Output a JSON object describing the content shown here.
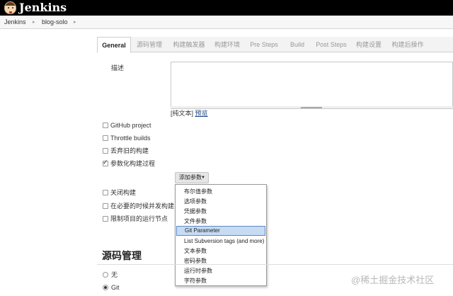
{
  "app": {
    "name": "Jenkins"
  },
  "breadcrumb": {
    "items": [
      "Jenkins",
      "blog-solo"
    ],
    "separator": "▸"
  },
  "tabs": [
    "General",
    "源码管理",
    "构建触发器",
    "构建环境",
    "Pre Steps",
    "Build",
    "Post Steps",
    "构建设置",
    "构建后操作"
  ],
  "general": {
    "description_label": "描述",
    "plain_text": "[纯文本]",
    "preview": "预览",
    "checkboxes": [
      {
        "label": "GitHub project",
        "checked": false
      },
      {
        "label": "Throttle builds",
        "checked": false
      },
      {
        "label": "丢弃旧的构建",
        "checked": false
      },
      {
        "label": "参数化构建过程",
        "checked": true
      },
      {
        "label": "关闭构建",
        "checked": false
      },
      {
        "label": "在必要的时候并发构建",
        "checked": false
      },
      {
        "label": "限制项目的运行节点",
        "checked": false
      }
    ],
    "add_param_button": "添加参数",
    "add_param_caret": "▼"
  },
  "dropdown": {
    "items": [
      "布尔值参数",
      "选项参数",
      "凭据参数",
      "文件参数",
      "Git Parameter",
      "List Subversion tags (and more)",
      "文本参数",
      "密码参数",
      "运行时参数",
      "字符参数"
    ],
    "highlighted_index": 4
  },
  "scm": {
    "title": "源码管理",
    "options": [
      {
        "label": "无",
        "checked": false
      },
      {
        "label": "Git",
        "checked": true
      }
    ]
  },
  "watermark": "@稀土掘金技术社区",
  "colors": {
    "header": "#000000",
    "highlight": "#c7dbf3",
    "link": "#204a87"
  }
}
